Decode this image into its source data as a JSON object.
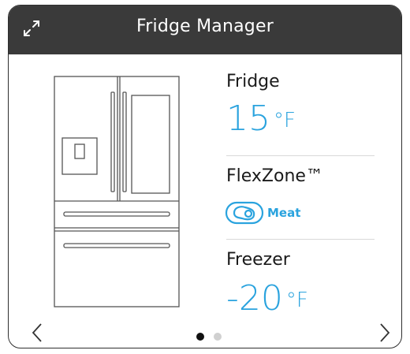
{
  "header": {
    "title": "Fridge Manager",
    "expand_icon": "expand-icon"
  },
  "fridge": {
    "label": "Fridge",
    "temp_value": "15",
    "temp_unit": "°F"
  },
  "flexzone": {
    "label": "FlexZone™",
    "mode_icon": "meat-icon",
    "mode_label": "Meat"
  },
  "freezer": {
    "label": "Freezer",
    "temp_value": "-20",
    "temp_unit": "°F"
  },
  "pagination": {
    "total_pages": 2,
    "current_page": 1
  },
  "colors": {
    "accent": "#2aa3de",
    "header_bg": "#3a3a3a",
    "dot_active": "#111111",
    "dot_inactive": "#d0d0d0"
  }
}
